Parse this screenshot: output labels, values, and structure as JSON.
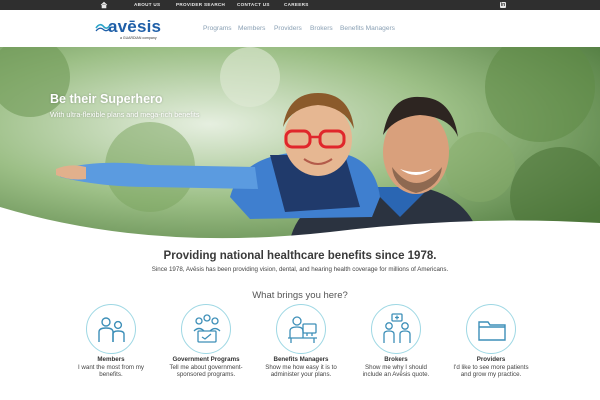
{
  "topbar": {
    "links": [
      "ABOUT US",
      "PROVIDER SEARCH",
      "CONTACT US",
      "CAREERS"
    ],
    "linkedin_label": "in"
  },
  "brand": {
    "name": "avēsis",
    "tagline": "a GUARDIAN company"
  },
  "nav": {
    "items": [
      "Programs",
      "Members",
      "Providers",
      "Brokers",
      "Benefits Managers"
    ]
  },
  "hero": {
    "title": "Be their Superhero",
    "subtitle": "With ultra-flexible plans and mega-rich benefits"
  },
  "intro": {
    "title": "Providing national healthcare benefits since 1978.",
    "text": "Since 1978, Avēsis has been providing vision, dental, and hearing health coverage for millions of Americans."
  },
  "brings": {
    "title": "What brings you here?"
  },
  "cards": [
    {
      "title": "Members",
      "desc1": "I want the most from my",
      "desc2": "benefits.",
      "icon": "members-icon"
    },
    {
      "title": "Government Programs",
      "desc1": "Tell me about government-",
      "desc2": "sponsored programs.",
      "icon": "government-programs-icon"
    },
    {
      "title": "Benefits Managers",
      "desc1": "Show me how easy it is to",
      "desc2": "administer your plans.",
      "icon": "benefits-manager-icon"
    },
    {
      "title": "Brokers",
      "desc1": "Show me why I should",
      "desc2": "include an Avēsis quote.",
      "icon": "brokers-icon"
    },
    {
      "title": "Providers",
      "desc1": "I'd like to see more patients",
      "desc2": "and grow my practice.",
      "icon": "folder-icon"
    }
  ],
  "colors": {
    "topbar": "#2f2f2f",
    "brand_blue": "#1f5fa8",
    "nav_text": "#8aa0b4",
    "icon_stroke": "#3d8fb8",
    "icon_circle": "#9fd8e4"
  }
}
